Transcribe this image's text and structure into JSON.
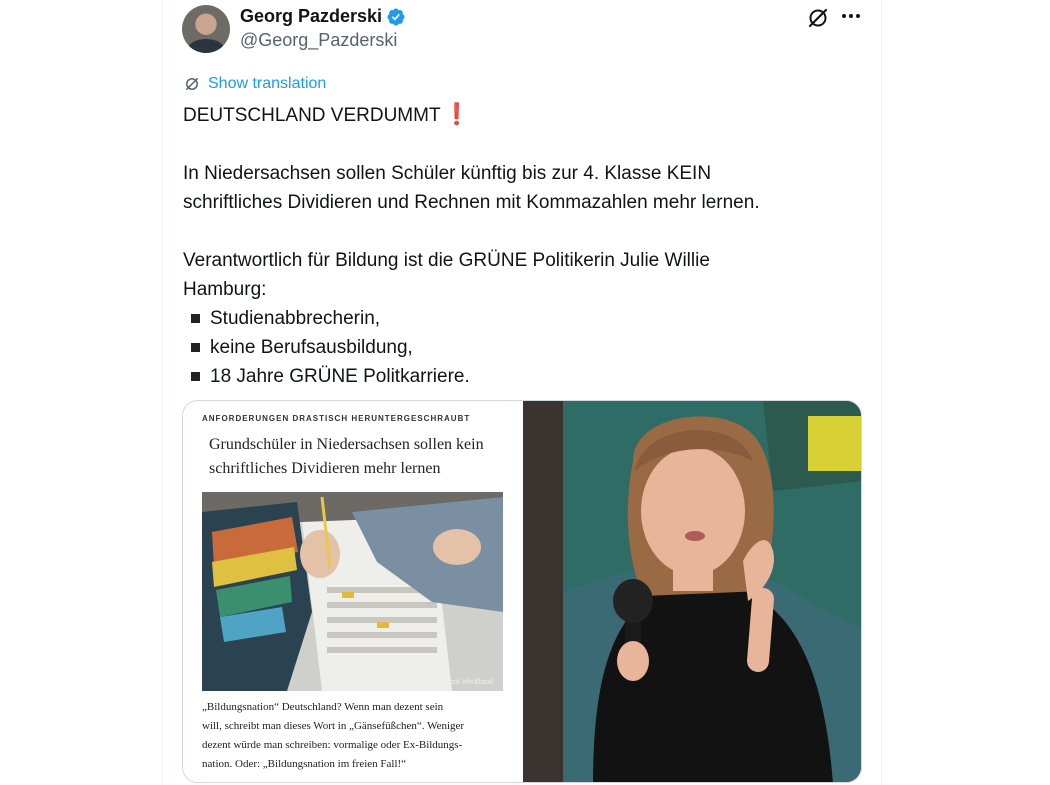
{
  "author": {
    "name": "Georg Pazderski",
    "handle": "@Georg_Pazderski"
  },
  "icons": {
    "verified": "verified-badge-icon",
    "grok": "grok-icon",
    "more": "more-icon",
    "translate": "translate-icon"
  },
  "translate_label": "Show translation",
  "tweet": {
    "headline": "DEUTSCHLAND VERDUMMT",
    "headline_emoji": "❗",
    "para1_line1": "In Niedersachsen sollen Schüler künftig bis zur 4. Klasse KEIN",
    "para1_line2": "schriftliches Dividieren und Rechnen mit Kommazahlen mehr lernen.",
    "para2_line1": "Verantwortlich für Bildung ist die GRÜNE Politikerin Julie Willie",
    "para2_line2": "Hamburg:",
    "bullets": [
      "Studienabbrecherin,",
      "keine Berufsausbildung,",
      "18 Jahre GRÜNE Politkarriere."
    ]
  },
  "media": {
    "kicker": "ANFORDERUNGEN DRASTISCH HERUNTERGESCHRAUBT",
    "headline_line1": "Grundschüler in Niedersachsen sollen kein",
    "headline_line2": "schriftliches Dividieren mehr lernen",
    "photo_credit": "picture alliance/dpa | Bernd Weißbrod",
    "caption_lines": [
      "„Bildungsnation“ Deutschland? Wenn man dezent sein",
      "will, schreibt man dieses Wort in „Gänsefüßchen“. Weniger",
      "dezent würde man schreiben: vormalige oder Ex-Bildungs-",
      "nation. Oder: „Bildungsnation im freien Fall!“"
    ]
  },
  "colors": {
    "link_blue": "#1d9bf0",
    "verified_blue": "#1d9bf0",
    "secondary_text": "#536471",
    "exclamation_red": "#dd2e44",
    "border": "#cfd9de"
  }
}
